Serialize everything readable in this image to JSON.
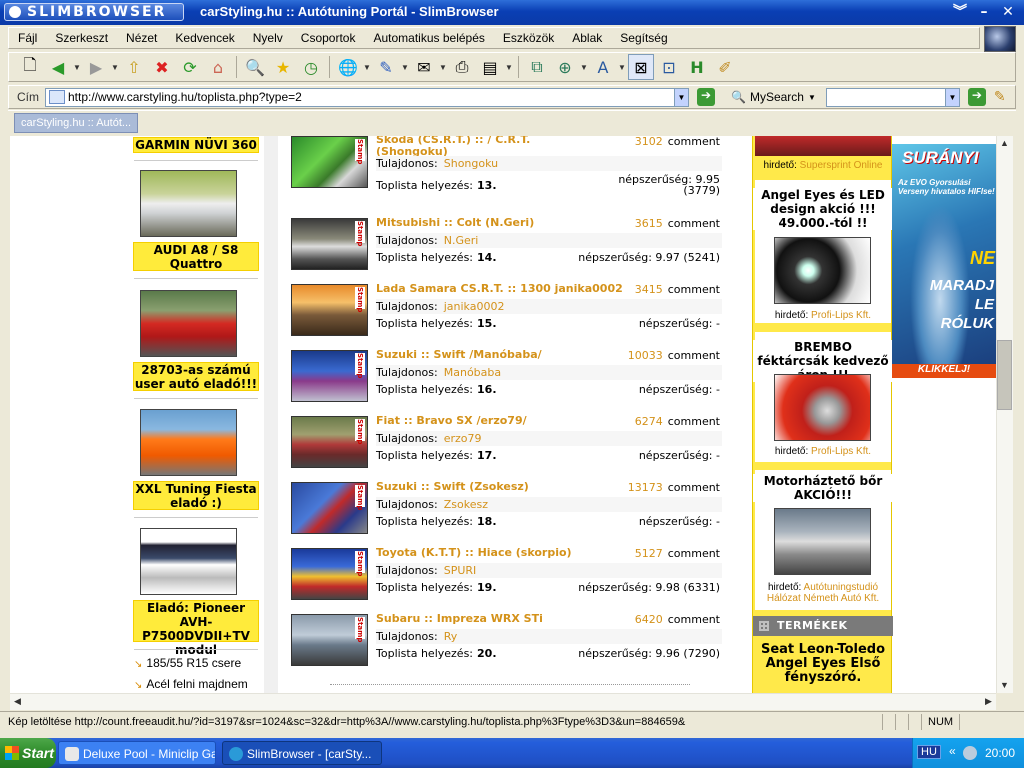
{
  "window": {
    "logo_text": "SLIMBROWSER",
    "title": "carStyling.hu :: Autótuning Portál - SlimBrowser"
  },
  "menu": [
    "Fájl",
    "Szerkeszt",
    "Nézet",
    "Kedvencek",
    "Nyelv",
    "Csoportok",
    "Automatikus belépés",
    "Eszközök",
    "Ablak",
    "Segítség"
  ],
  "address": {
    "label": "Cím",
    "url": "http://www.carstyling.hu/toplista.php?type=2",
    "search_label": "MySearch"
  },
  "tabs": [
    "carStyling.hu :: Autót..."
  ],
  "left_column": {
    "top_caption": "GARMIN NÜVI 360",
    "items": [
      {
        "caption": "AUDI A8 / S8 Quattro"
      },
      {
        "caption": "28703-as számú user autó eladó!!!"
      },
      {
        "caption": "XXL Tuning Fiesta eladó :)"
      },
      {
        "caption": "Eladó: Pioneer AVH-P7500DVDII+TV modul"
      }
    ],
    "links": [
      "185/55 R15 csere",
      "Acél felni majdnem"
    ]
  },
  "toplist": {
    "owner_label": "Tulajdonos:",
    "rank_label": "Toplista helyezés:",
    "popularity_label": "népszerűség:",
    "comment_word": "comment",
    "entries": [
      {
        "title": "Skoda (CS.R.T.) :: / C.R.T. (Shongoku)",
        "comments": "3102",
        "owner": "Shongoku",
        "rank": "13.",
        "popularity": "9.95 (3779)"
      },
      {
        "title": "Mitsubishi :: Colt (N.Geri)",
        "comments": "3615",
        "owner": "N.Geri",
        "rank": "14.",
        "popularity": "9.97 (5241)"
      },
      {
        "title": "Lada Samara CS.R.T. :: 1300 janika0002",
        "comments": "3415",
        "owner": "janika0002",
        "rank": "15.",
        "popularity": "-"
      },
      {
        "title": "Suzuki :: Swift /Manóbaba/",
        "comments": "10033",
        "owner": "Manóbaba",
        "rank": "16.",
        "popularity": "-"
      },
      {
        "title": "Fiat :: Bravo SX /erzo79/",
        "comments": "6274",
        "owner": "erzo79",
        "rank": "17.",
        "popularity": "-"
      },
      {
        "title": "Suzuki :: Swift (Zsokesz)",
        "comments": "13173",
        "owner": "Zsokesz",
        "rank": "18.",
        "popularity": "-"
      },
      {
        "title": "Toyota (K.T.T) :: Hiace (skorpio)",
        "comments": "5127",
        "owner": "SPURI",
        "rank": "19.",
        "popularity": "9.98 (6331)"
      },
      {
        "title": "Subaru :: Impreza WRX STi",
        "comments": "6420",
        "owner": "Ry",
        "rank": "20.",
        "popularity": "9.96 (7290)"
      }
    ],
    "stamp": "Stamp"
  },
  "ads": {
    "advertiser_label": "hirdető:",
    "items": [
      {
        "advertiser": "Supersprint Online"
      },
      {
        "title": "Angel Eyes és LED design akció !!! 49.000.-tól !!",
        "advertiser": "Profi-Lips Kft."
      },
      {
        "title": "BREMBO féktárcsák kedvező áron !!!",
        "advertiser": "Profi-Lips Kft."
      },
      {
        "title": "Motorháztető bőr AKCIÓ!!!",
        "advertiser": "Autótuningstudió Hálózat Németh Autó Kft."
      }
    ],
    "products_header": "TERMÉKEK",
    "product_title": "Seat Leon-Toledo Angel Eyes Első fényszóró."
  },
  "banner": {
    "brand": "SURÁNYI",
    "sub": "Az EVO Gyorsulási Verseny hivatalos HIFIse!",
    "ne": "NE",
    "text": "MARADJ LE RÓLUK",
    "cta": "KLIKKELJ!"
  },
  "status": {
    "text": "Kép letöltése http://count.freeaudit.hu/?id=3197&sr=1024&sc=32&dr=http%3A//www.carstyling.hu/toplista.php%3Ftype%3D3&un=884659&",
    "num": "NUM"
  },
  "taskbar": {
    "start": "Start",
    "tasks": [
      "Deluxe Pool - Miniclip Ga...",
      "SlimBrowser - [carSty..."
    ],
    "lang": "HU",
    "clock": "20:00"
  },
  "colors": {
    "accent_orange": "#d4921a",
    "ad_yellow": "#ffe94a"
  }
}
